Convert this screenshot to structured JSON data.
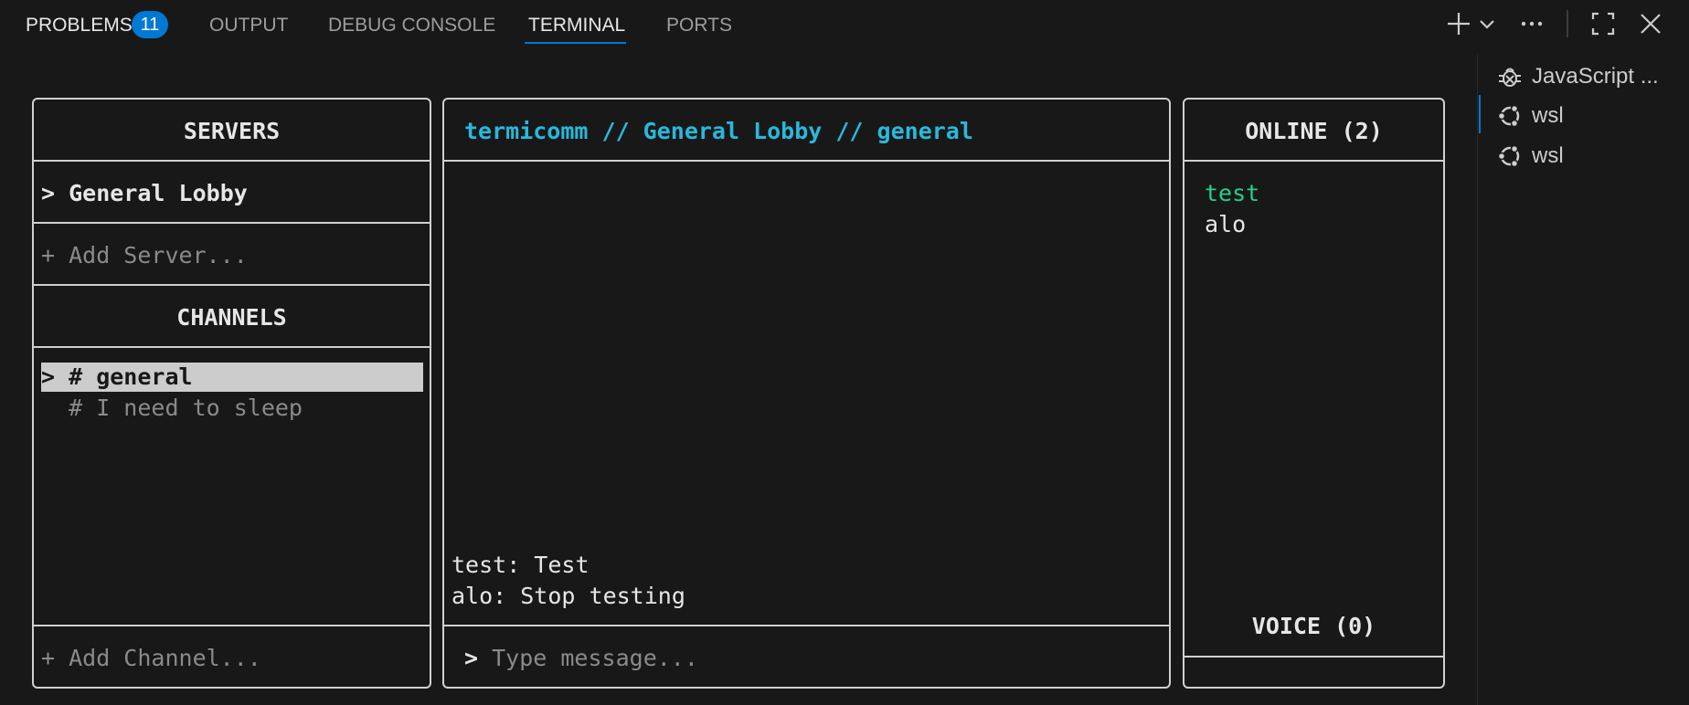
{
  "panel": {
    "tabs": {
      "problems": "PROBLEMS",
      "problems_count": "11",
      "output": "OUTPUT",
      "debug_console": "DEBUG CONSOLE",
      "terminal": "TERMINAL",
      "ports": "PORTS"
    },
    "active_tab": "TERMINAL",
    "accent_color": "#0078d4",
    "toolbar_icons": [
      "plus-icon",
      "chevron-down-icon",
      "more-icon",
      "maximize-icon",
      "close-icon"
    ]
  },
  "terminal_list": [
    {
      "label": "JavaScript ...",
      "icon": "debug-icon"
    },
    {
      "label": "wsl",
      "icon": "ubuntu-icon",
      "active": true
    },
    {
      "label": "wsl",
      "icon": "ubuntu-icon"
    }
  ],
  "tui": {
    "servers": {
      "title": "SERVERS",
      "items": [
        {
          "prefix": ">",
          "label": "General Lobby"
        }
      ],
      "add_label": "+ Add Server..."
    },
    "channels": {
      "title": "CHANNELS",
      "items": [
        {
          "text": "> # general",
          "selected": true
        },
        {
          "text": "  # I need to sleep",
          "selected": false
        }
      ],
      "add_label": "+ Add Channel..."
    },
    "chat": {
      "header": "termicomm // General Lobby // general",
      "messages": [
        "test: Test",
        "alo: Stop testing"
      ],
      "input_prompt": ">",
      "input_placeholder": "Type message..."
    },
    "online": {
      "title": "ONLINE (2)",
      "users": [
        {
          "name": "test",
          "color": "#23d18b"
        },
        {
          "name": "alo",
          "color": "#e6e6e6"
        }
      ],
      "voice_title": "VOICE (0)"
    }
  }
}
